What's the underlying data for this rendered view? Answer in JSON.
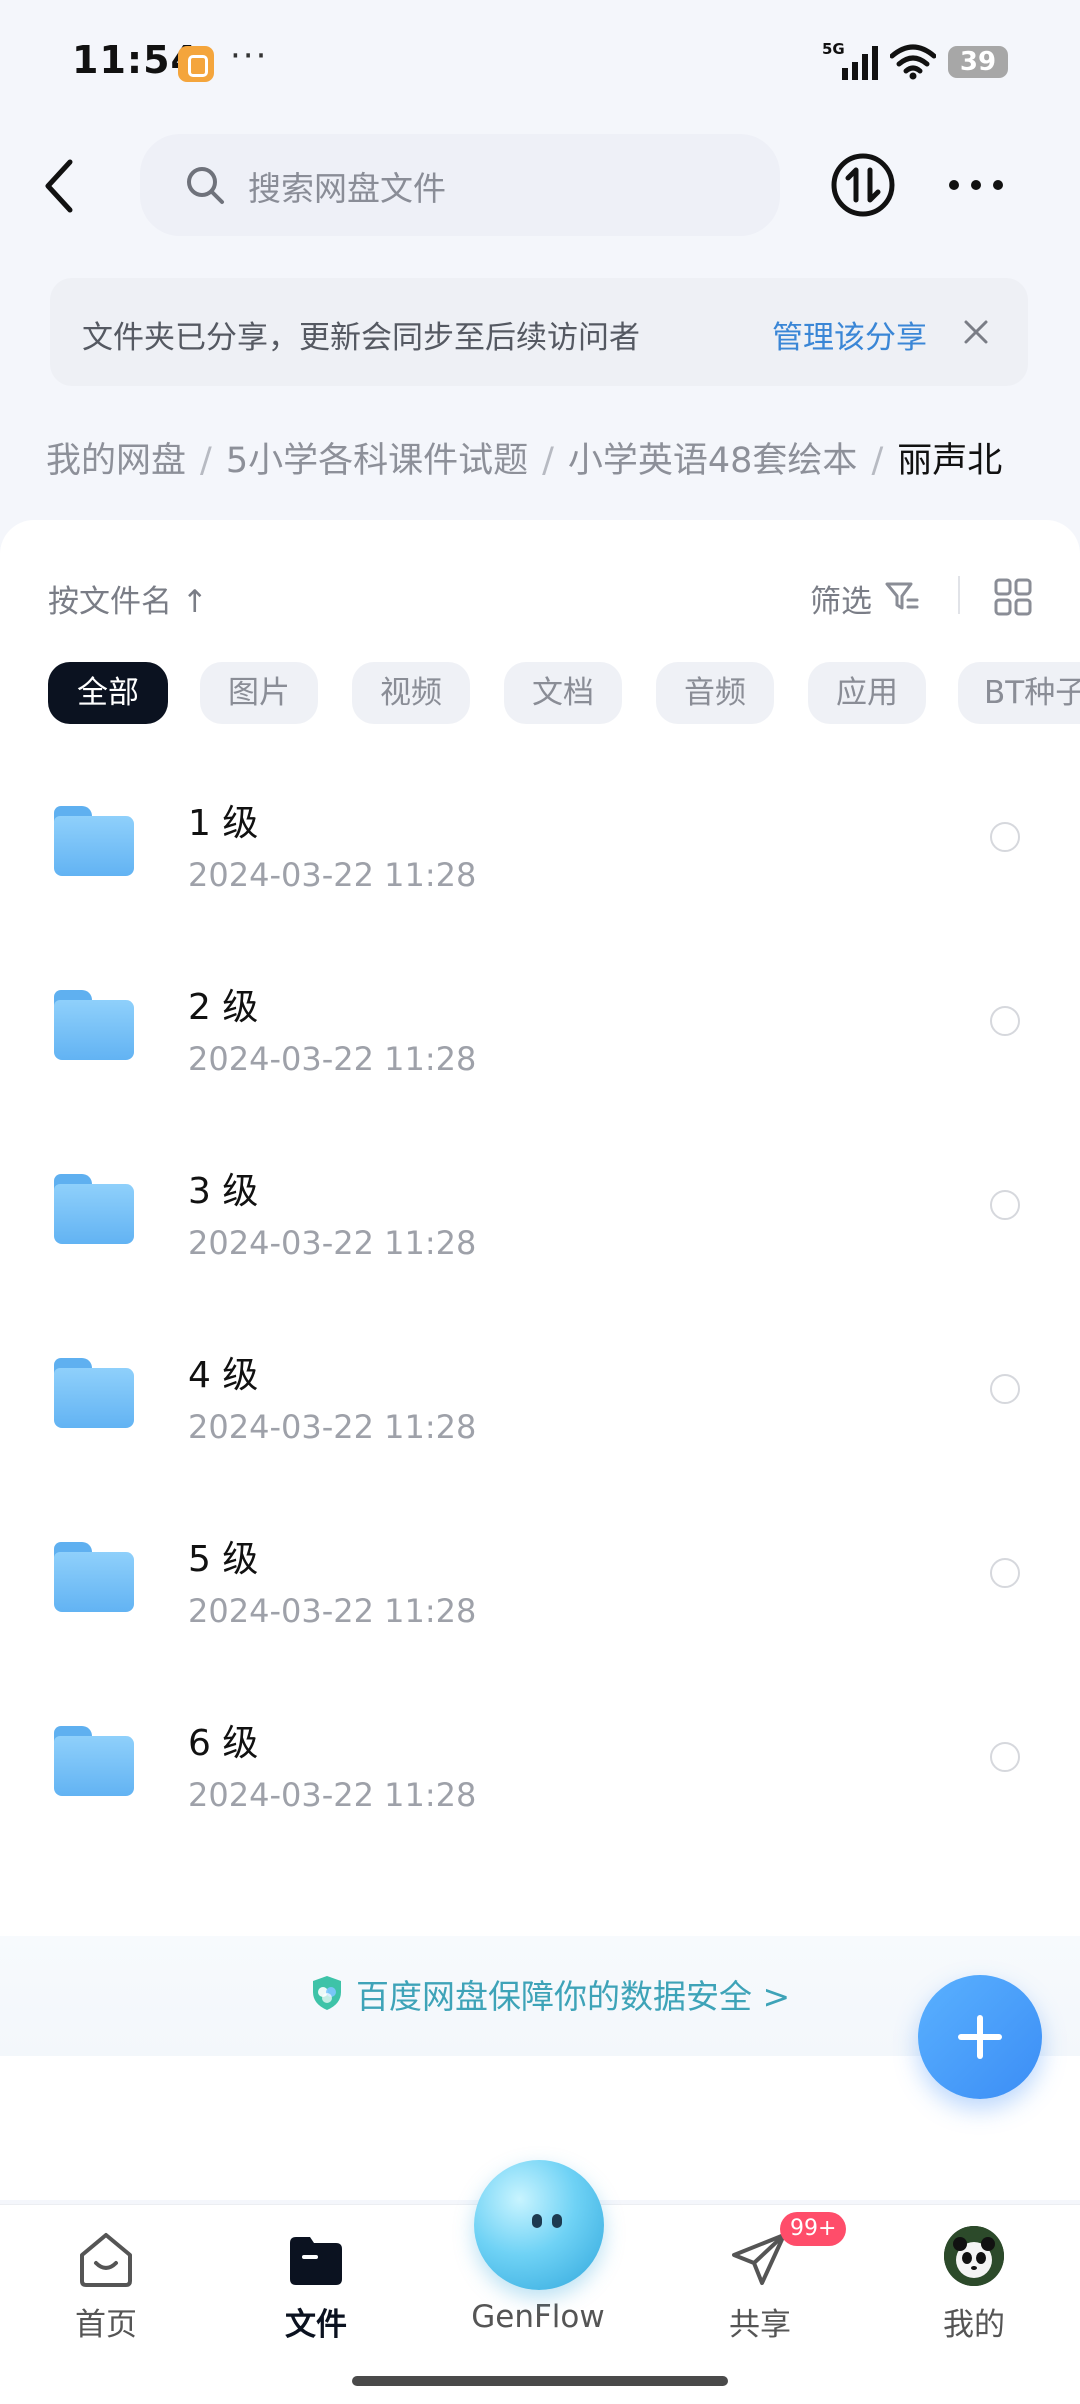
{
  "status_bar": {
    "time": "11:54",
    "more": "···",
    "network": "5G",
    "battery": "39"
  },
  "header": {
    "search_placeholder": "搜索网盘文件"
  },
  "banner": {
    "text": "文件夹已分享，更新会同步至后续访问者",
    "link": "管理该分享"
  },
  "breadcrumb": [
    "我的网盘",
    "5小学各科课件试题",
    "小学英语48套绘本",
    "丽声北"
  ],
  "toolbar": {
    "sort_label": "按文件名 ↑",
    "filter_label": "筛选"
  },
  "filters": [
    "全部",
    "图片",
    "视频",
    "文档",
    "音频",
    "应用",
    "BT种子"
  ],
  "files": [
    {
      "name": "1 级",
      "date": "2024-03-22  11:28"
    },
    {
      "name": "2 级",
      "date": "2024-03-22  11:28"
    },
    {
      "name": "3 级",
      "date": "2024-03-22  11:28"
    },
    {
      "name": "4 级",
      "date": "2024-03-22  11:28"
    },
    {
      "name": "5 级",
      "date": "2024-03-22  11:28"
    },
    {
      "name": "6 级",
      "date": "2024-03-22  11:28"
    }
  ],
  "security_tip": "百度网盘保障你的数据安全 >",
  "nav": {
    "items": [
      {
        "label": "首页",
        "icon": "home-icon"
      },
      {
        "label": "文件",
        "icon": "folder-icon",
        "active": true
      },
      {
        "label": "GenFlow",
        "icon": "genflow-orb"
      },
      {
        "label": "共享",
        "icon": "paper-plane-icon",
        "badge": "99+"
      },
      {
        "label": "我的",
        "icon": "avatar"
      }
    ]
  },
  "colors": {
    "accent": "#3a86d6",
    "active_chip": "#0b1220",
    "folder": "#62b3f3",
    "badge": "#ff4d6a"
  }
}
